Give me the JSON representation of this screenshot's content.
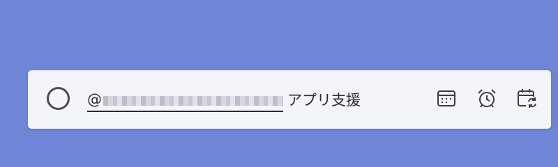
{
  "task": {
    "mention_prefix": "@",
    "mention_redacted": true,
    "title_text": "アプリ支援"
  },
  "toolbar": {
    "items": [
      {
        "name": "due-date",
        "icon": "calendar-icon"
      },
      {
        "name": "reminder",
        "icon": "alarm-clock-icon"
      },
      {
        "name": "repeat",
        "icon": "calendar-repeat-icon"
      }
    ]
  },
  "colors": {
    "background": "#6f86d6",
    "card": "#f3f5fb",
    "text": "#2b2b2b",
    "icon": "#3c3c3c"
  }
}
